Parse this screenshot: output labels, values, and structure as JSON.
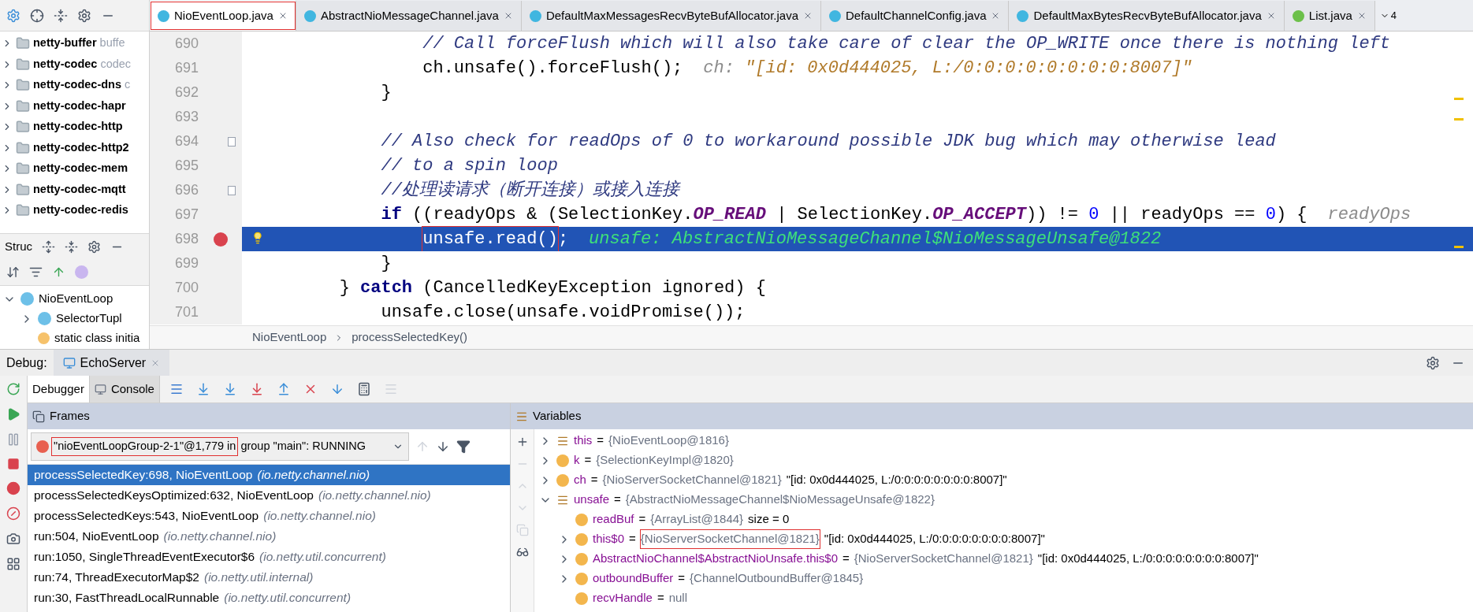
{
  "project": {
    "items": [
      {
        "name": "netty-buffer",
        "description": "buffe"
      },
      {
        "name": "netty-codec",
        "description": "codec"
      },
      {
        "name": "netty-codec-dns",
        "description": "c"
      },
      {
        "name": "netty-codec-hapr"
      },
      {
        "name": "netty-codec-http"
      },
      {
        "name": "netty-codec-http2"
      },
      {
        "name": "netty-codec-mem"
      },
      {
        "name": "netty-codec-mqtt"
      },
      {
        "name": "netty-codec-redis"
      }
    ]
  },
  "structure": {
    "title": "Struc",
    "items": [
      {
        "name": "NioEventLoop",
        "expanded": true,
        "children": [
          {
            "name": "SelectorTupl",
            "kind": "class",
            "expanded": false
          },
          {
            "name": "static class initia",
            "kind": "initializer"
          }
        ]
      }
    ]
  },
  "editor_tabs": {
    "tabs": [
      {
        "label": "NioEventLoop.java",
        "kind": "class",
        "selected": true,
        "highlighted": true
      },
      {
        "label": "AbstractNioMessageChannel.java",
        "kind": "class",
        "selected": false,
        "highlighted": false
      },
      {
        "label": "DefaultMaxMessagesRecvByteBufAllocator.java",
        "kind": "class",
        "selected": false,
        "highlighted": false
      },
      {
        "label": "DefaultChannelConfig.java",
        "kind": "class",
        "selected": false,
        "highlighted": false
      },
      {
        "label": "DefaultMaxBytesRecvByteBufAllocator.java",
        "kind": "class",
        "selected": false,
        "highlighted": false
      },
      {
        "label": "List.java",
        "kind": "interface",
        "selected": false,
        "highlighted": false
      }
    ],
    "hidden_count": "4"
  },
  "code": {
    "lines": [
      {
        "number": "690",
        "segments": [
          {
            "kind": "comment",
            "text": "                // Call forceFlush which will also take care of clear the OP_WRITE once there is nothing left"
          }
        ]
      },
      {
        "number": "691",
        "segments": [
          {
            "kind": "code",
            "text": "                ch.unsafe().forceFlush();"
          },
          {
            "kind": "hint",
            "text": "ch: "
          },
          {
            "kind": "hint_value",
            "text": "\"[id: 0x0d444025, L:/0:0:0:0:0:0:0:0:8007]\""
          }
        ]
      },
      {
        "number": "692",
        "segments": [
          {
            "kind": "code",
            "text": "            }"
          }
        ]
      },
      {
        "number": "693"
      },
      {
        "number": "694",
        "fold": true,
        "segments": [
          {
            "kind": "comment",
            "text": "            // Also check for readOps of 0 to workaround possible JDK bug which may otherwise lead"
          }
        ]
      },
      {
        "number": "695",
        "segments": [
          {
            "kind": "comment",
            "text": "            // to a spin loop"
          }
        ]
      },
      {
        "number": "696",
        "fold": true,
        "segments": [
          {
            "kind": "comment",
            "text": "            //处理读请求（断开连接）或接入连接"
          }
        ]
      },
      {
        "number": "697",
        "segments": [
          {
            "kind": "keyword",
            "text": "            if"
          },
          {
            "kind": "code",
            "text": " ((readyOps & (SelectionKey."
          },
          {
            "kind": "constant",
            "text": "OP_READ"
          },
          {
            "kind": "code",
            "text": " | SelectionKey."
          },
          {
            "kind": "constant",
            "text": "OP_ACCEPT"
          },
          {
            "kind": "code",
            "text": ")) != "
          },
          {
            "kind": "number",
            "text": "0"
          },
          {
            "kind": "code",
            "text": " || readyOps == "
          },
          {
            "kind": "number",
            "text": "0"
          },
          {
            "kind": "code",
            "text": ") {"
          },
          {
            "kind": "hint",
            "text": "readyOps"
          }
        ]
      },
      {
        "number": "698",
        "selected": true,
        "breakpoint": true,
        "bulb": true,
        "segments": [
          {
            "kind": "code",
            "text": "                unsafe.read()",
            "highlighted": true
          },
          {
            "kind": "code",
            "text": ";"
          },
          {
            "kind": "hint",
            "text": "unsafe: AbstractNioMessageChannel$NioMessageUnsafe@1822"
          }
        ]
      },
      {
        "number": "699",
        "segments": [
          {
            "kind": "code",
            "text": "            }"
          }
        ]
      },
      {
        "number": "700",
        "segments": [
          {
            "kind": "code",
            "text": "        } "
          },
          {
            "kind": "keyword",
            "text": "catch"
          },
          {
            "kind": "code",
            "text": " (CancelledKeyException ignored) {"
          }
        ]
      },
      {
        "number": "701",
        "segments": [
          {
            "kind": "code",
            "text": "            unsafe.close(unsafe.voidPromise());"
          }
        ]
      }
    ]
  },
  "breadcrumb": [
    "NioEventLoop",
    "processSelectedKey()"
  ],
  "debug": {
    "label": "Debug:",
    "session_tab": "EchoServer",
    "tabs": [
      {
        "label": "Debugger",
        "selected": true
      },
      {
        "label": "Console",
        "selected": false
      }
    ],
    "frames": {
      "title": "Frames",
      "thread": [
        {
          "text": "\"nioEventLoopGroup-2-1\"@1,779 in",
          "highlighted": true
        },
        {
          "text": "group \"main\": RUNNING",
          "highlighted": false
        }
      ],
      "items": [
        {
          "method": "processSelectedKey:698, NioEventLoop",
          "package": "(io.netty.channel.nio)",
          "selected": true
        },
        {
          "method": "processSelectedKeysOptimized:632, NioEventLoop",
          "package": "(io.netty.channel.nio)",
          "selected": false
        },
        {
          "method": "processSelectedKeys:543, NioEventLoop",
          "package": "(io.netty.channel.nio)",
          "selected": false
        },
        {
          "method": "run:504, NioEventLoop",
          "package": "(io.netty.channel.nio)",
          "selected": false
        },
        {
          "method": "run:1050, SingleThreadEventExecutor$6",
          "package": "(io.netty.util.concurrent)",
          "selected": false
        },
        {
          "method": "run:74, ThreadExecutorMap$2",
          "package": "(io.netty.util.internal)",
          "selected": false
        },
        {
          "method": "run:30, FastThreadLocalRunnable",
          "package": "(io.netty.util.concurrent)",
          "selected": false
        }
      ]
    },
    "variables": {
      "title": "Variables",
      "items": [
        {
          "kind": "object",
          "name": "this",
          "sep": "=",
          "value": "{NioEventLoop@1816}",
          "expanded": false
        },
        {
          "kind": "parameter",
          "name": "k",
          "sep": "=",
          "value": "{SelectionKeyImpl@1820}",
          "expanded": false
        },
        {
          "kind": "parameter",
          "name": "ch",
          "sep": "=",
          "value": "{NioServerSocketChannel@1821}",
          "extra": "\"[id: 0x0d444025, L:/0:0:0:0:0:0:0:0:8007]\"",
          "expanded": false
        },
        {
          "kind": "object",
          "name": "unsafe",
          "sep": "=",
          "value": "{AbstractNioMessageChannel$NioMessageUnsafe@1822}",
          "expanded": true,
          "children": [
            {
              "kind": "field",
              "name": "readBuf",
              "sep": "=",
              "value": "{ArrayList@1844}",
              "extra": "size = 0"
            },
            {
              "kind": "field",
              "name": "this$0",
              "sep": "=",
              "value": "{NioServerSocketChannel@1821}",
              "highlighted": true,
              "extra": "\"[id: 0x0d444025, L:/0:0:0:0:0:0:0:0:8007]\"",
              "expanded": false
            },
            {
              "kind": "field",
              "name": "AbstractNioChannel$AbstractNioUnsafe.this$0",
              "sep": "=",
              "value": "{NioServerSocketChannel@1821}",
              "extra": "\"[id: 0x0d444025, L:/0:0:0:0:0:0:0:0:8007]\"",
              "expanded": false
            },
            {
              "kind": "field",
              "name": "outboundBuffer",
              "sep": "=",
              "value": "{ChannelOutboundBuffer@1845}",
              "expanded": false
            },
            {
              "kind": "field",
              "name": "recvHandle",
              "sep": "=",
              "value": "null"
            }
          ]
        }
      ]
    }
  }
}
